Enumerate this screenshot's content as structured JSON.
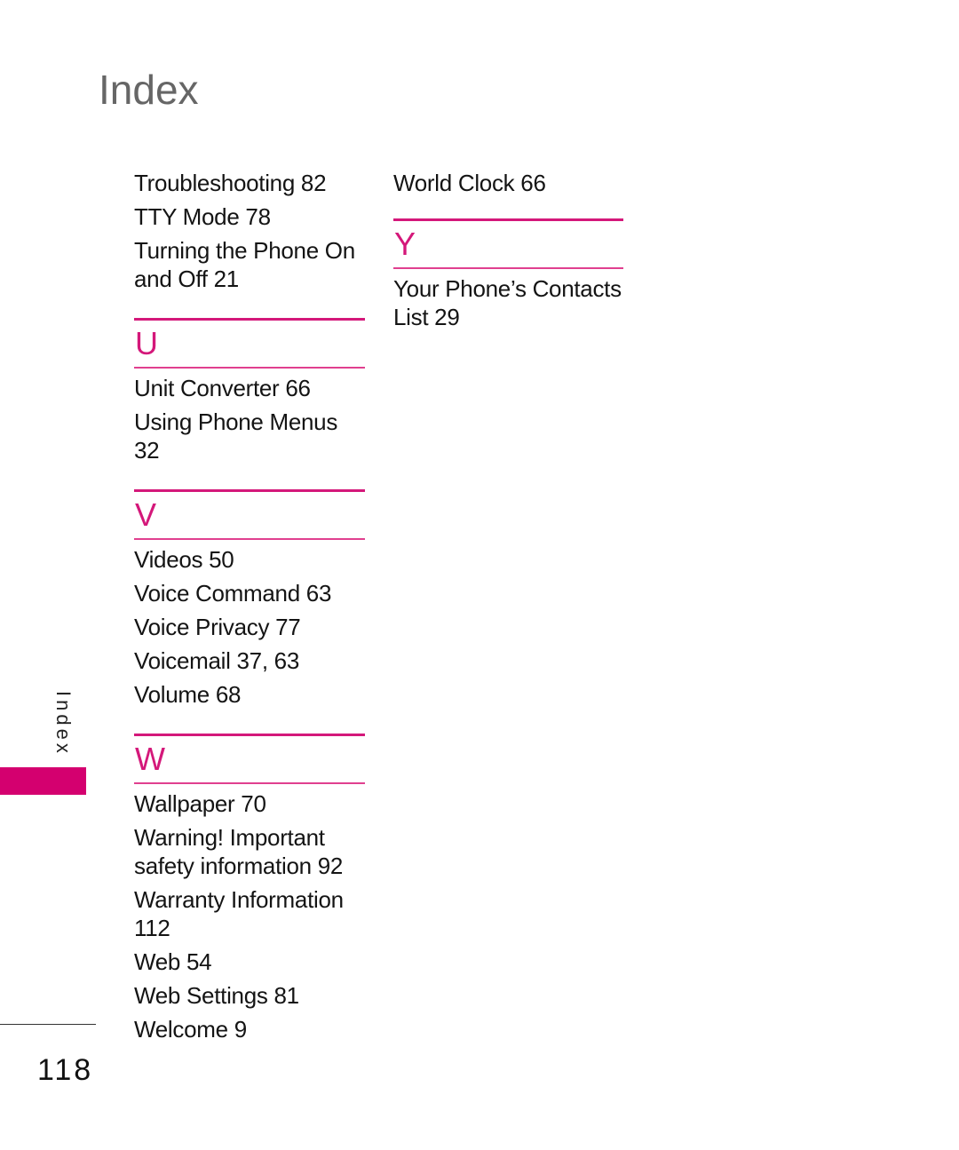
{
  "header": {
    "title": "Index"
  },
  "left_column": {
    "entries_top": [
      "Troubleshooting 82",
      "TTY Mode 78",
      "Turning the Phone On and Off 21"
    ],
    "sections": [
      {
        "letter": "U",
        "entries": [
          "Unit Converter 66",
          "Using Phone Menus 32"
        ]
      },
      {
        "letter": "V",
        "entries": [
          "Videos 50",
          "Voice Command 63",
          "Voice Privacy 77",
          "Voicemail 37, 63",
          "Volume 68"
        ]
      },
      {
        "letter": "W",
        "entries": [
          "Wallpaper 70",
          "Warning! Important safety information 92",
          "Warranty Information 112",
          "Web 54",
          "Web Settings 81",
          "Welcome 9"
        ]
      }
    ]
  },
  "right_column": {
    "entries_top": [
      "World Clock 66"
    ],
    "sections": [
      {
        "letter": "Y",
        "entries": [
          "Your Phone’s Contacts List 29"
        ]
      }
    ]
  },
  "side_tab": {
    "label": "Index"
  },
  "footer": {
    "page_number": "118"
  },
  "colors": {
    "accent": "#d4187a",
    "tab": "#d4006f",
    "title": "#666666"
  }
}
